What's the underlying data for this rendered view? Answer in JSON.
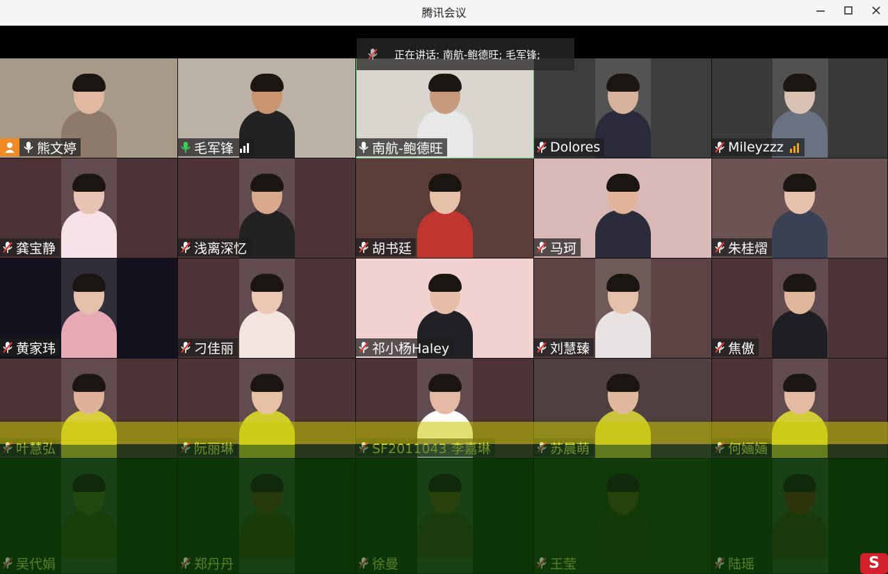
{
  "window": {
    "title": "腾讯会议",
    "minimize_icon": "minimize-icon",
    "maximize_icon": "maximize-icon",
    "close_icon": "close-icon"
  },
  "speaking_banner": {
    "text": "正在讲话: 南航-鲍德旺; 毛军锋;"
  },
  "participants": [
    {
      "name": "熊文婷",
      "mic": "on",
      "host": true,
      "signal": false,
      "bg": "#a89a88",
      "skin": "#e0b9a0",
      "shirt": "#8d7a6a",
      "active": false
    },
    {
      "name": "毛军锋",
      "mic": "on-green",
      "host": false,
      "signal": true,
      "bg": "#bcb1a6",
      "skin": "#c9946f",
      "shirt": "#222222",
      "active": false
    },
    {
      "name": "南航-鲍德旺",
      "mic": "on",
      "host": false,
      "signal": false,
      "bg": "#d9d6cf",
      "skin": "#c79a7c",
      "shirt": "#e8e8e8",
      "active": true
    },
    {
      "name": "Dolores",
      "mic": "muted",
      "host": false,
      "signal": false,
      "bg": "#3c3c3c",
      "skin": "#d6b39a",
      "shirt": "#2a2a3a",
      "active": false
    },
    {
      "name": "Mileyzzz",
      "mic": "muted",
      "host": false,
      "signal": true,
      "bg": "#3a3a3a",
      "skin": "#d8c2b4",
      "shirt": "#6a7282",
      "active": false
    },
    {
      "name": "龚宝静",
      "mic": "muted",
      "host": false,
      "signal": false,
      "bg": "#4c3336",
      "skin": "#e8c3b4",
      "shirt": "#f5e1e6",
      "active": false
    },
    {
      "name": "浅离深忆",
      "mic": "muted",
      "host": false,
      "signal": false,
      "bg": "#4c3336",
      "skin": "#d9a98c",
      "shirt": "#222222",
      "active": false
    },
    {
      "name": "胡书廷",
      "mic": "muted",
      "host": false,
      "signal": false,
      "bg": "#5a3c38",
      "skin": "#e7c0a8",
      "shirt": "#c0362f",
      "active": false
    },
    {
      "name": "马珂",
      "mic": "muted",
      "host": false,
      "signal": false,
      "bg": "#d9b8b8",
      "skin": "#e1b49a",
      "shirt": "#2b2b3a",
      "active": false
    },
    {
      "name": "朱桂熠",
      "mic": "muted",
      "host": false,
      "signal": false,
      "bg": "#6c5454",
      "skin": "#e6c1ac",
      "shirt": "#3a4154",
      "active": false
    },
    {
      "name": "黄家玮",
      "mic": "muted",
      "host": false,
      "signal": false,
      "bg": "#14121e",
      "skin": "#e7c0ad",
      "shirt": "#e7a9b4",
      "active": false
    },
    {
      "name": "刁佳丽",
      "mic": "muted",
      "host": false,
      "signal": false,
      "bg": "#4c3336",
      "skin": "#ecc7b4",
      "shirt": "#f2e4df",
      "active": false
    },
    {
      "name": "祁小杨Haley",
      "mic": "muted",
      "host": false,
      "signal": false,
      "bg": "#f1d2d1",
      "skin": "#e8bea8",
      "shirt": "#222226",
      "active": false
    },
    {
      "name": "刘慧臻",
      "mic": "muted",
      "host": false,
      "signal": false,
      "bg": "#5c4444",
      "skin": "#e6c0a8",
      "shirt": "#e9e2e2",
      "active": false
    },
    {
      "name": "焦傲",
      "mic": "muted",
      "host": false,
      "signal": false,
      "bg": "#4c3336",
      "skin": "#e1b79c",
      "shirt": "#202024",
      "active": false
    },
    {
      "name": "叶慧弘",
      "mic": "muted",
      "host": false,
      "signal": false,
      "bg": "#4c3336",
      "skin": "#ddb19a",
      "shirt": "#d9cf3a",
      "active": false
    },
    {
      "name": "阮丽琳",
      "mic": "muted",
      "host": false,
      "signal": false,
      "bg": "#4c3336",
      "skin": "#e6c1a6",
      "shirt": "#cfcc2f",
      "active": false
    },
    {
      "name": "SF2011043 李嘉琳",
      "mic": "muted",
      "host": false,
      "signal": false,
      "bg": "#4c3336",
      "skin": "#e4b9a4",
      "shirt": "#ffffff",
      "active": false
    },
    {
      "name": "苏晨萌",
      "mic": "muted",
      "host": false,
      "signal": false,
      "bg": "#4e4040",
      "skin": "#e0b99c",
      "shirt": "#c8c538",
      "active": false
    },
    {
      "name": "何婳婳",
      "mic": "muted",
      "host": false,
      "signal": false,
      "bg": "#4c3336",
      "skin": "#e3bba2",
      "shirt": "#d2cd36",
      "active": false
    },
    {
      "name": "吴代娟",
      "mic": "muted",
      "host": false,
      "signal": false,
      "bg": "#0e2f0b",
      "skin": "#3d5a1a",
      "shirt": "#28420f",
      "active": false
    },
    {
      "name": "郑丹丹",
      "mic": "muted",
      "host": false,
      "signal": false,
      "bg": "#0e2f0b",
      "skin": "#4a3810",
      "shirt": "#2b3a0f",
      "active": false
    },
    {
      "name": "徐曼",
      "mic": "muted",
      "host": false,
      "signal": false,
      "bg": "#0e2f0b",
      "skin": "#4c4814",
      "shirt": "#2e3b10",
      "active": false
    },
    {
      "name": "王莹",
      "mic": "muted",
      "host": false,
      "signal": false,
      "bg": "#1a380d",
      "skin": "#4a4a16",
      "shirt": "#24350c",
      "active": false
    },
    {
      "name": "陆瑶",
      "mic": "muted",
      "host": false,
      "signal": false,
      "bg": "#0e2f0b",
      "skin": "#5a2a12",
      "shirt": "#2a3a10",
      "active": false
    }
  ],
  "colors": {
    "mic_muted_slash": "#e03a3a",
    "mic_green": "#3ecf5a",
    "host_badge": "#f08a24",
    "signal_orange": "#f0a020",
    "glitch_yellow": "#c8c800",
    "glitch_green": "#0b3d08"
  },
  "corner_logo": {
    "letter": "S",
    "icon": "sogou-ime-icon"
  }
}
